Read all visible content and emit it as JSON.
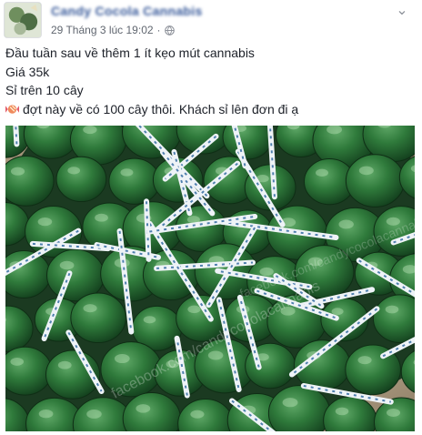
{
  "post": {
    "page_name": "Candy Cocola Cannabis",
    "timestamp": "29 Tháng 3 lúc 19:02",
    "separator": "·",
    "privacy_icon": "globe-icon",
    "more_icon": "chevron-down-icon",
    "lines": [
      "Đầu tuần sau về thêm 1 ít kẹo mút cannabis",
      "Giá 35k",
      "Sỉ trên 10 cây",
      "đợt này về có 100 cây thôi. Khách sỉ lên đơn đi ạ"
    ],
    "emoji_icon": "candy-emoji-icon",
    "photo_watermark": "facebook.com/candycocolacannabis"
  }
}
